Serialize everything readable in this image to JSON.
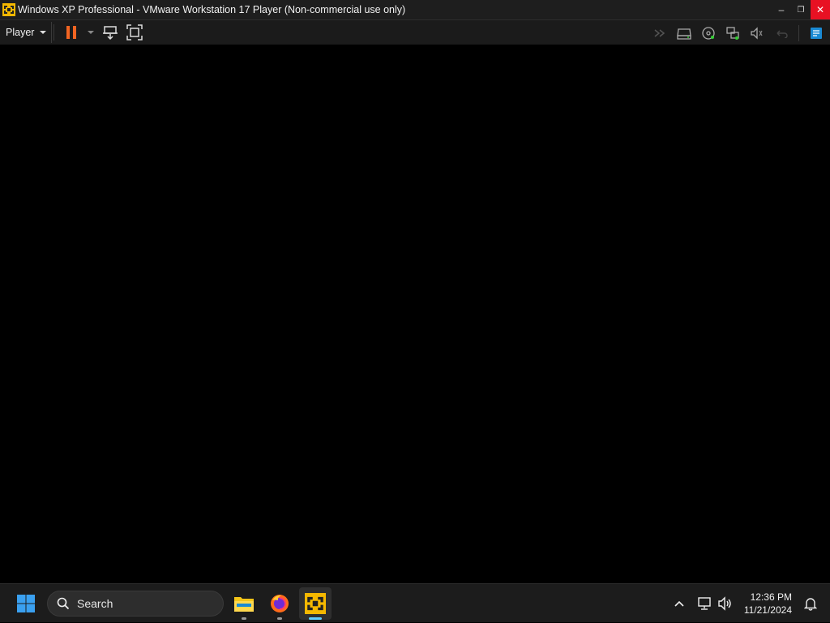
{
  "window": {
    "title": "Windows XP Professional - VMware Workstation 17 Player (Non-commercial use only)",
    "controls": {
      "minimize_glyph": "–",
      "restore_glyph": "❐",
      "close_glyph": "✕"
    }
  },
  "toolbar": {
    "player_menu_label": "Player",
    "left_icons": [
      "pause-icon",
      "dropdown-arrow-icon",
      "send-ctrl-alt-del-icon",
      "fullscreen-icon"
    ],
    "right_icons": [
      "forward-icon",
      "removable-drive-icon",
      "cd-dvd-icon",
      "network-adapter-icon",
      "sound-card-icon",
      "back-icon",
      "notes-icon"
    ],
    "accent_pause": "#f26522",
    "accent_notes": "#1a8ad4"
  },
  "taskbar": {
    "search_label": "Search",
    "apps": [
      "file-explorer-icon",
      "firefox-icon",
      "vmware-player-icon"
    ],
    "tray_icons": [
      "chevron-up-icon",
      "network-icon",
      "volume-icon"
    ],
    "clock_time": "12:36 PM",
    "clock_date": "11/21/2024",
    "notification_icon": "bell-icon"
  },
  "colors": {
    "titlebar_bg": "#1e1e1e",
    "close_red": "#e81123",
    "taskbar_bg": "#1c1c1c",
    "vm_screen": "#000000",
    "windows_blue": "#3aa0f0",
    "vmware_yellow": "#f5b800"
  }
}
